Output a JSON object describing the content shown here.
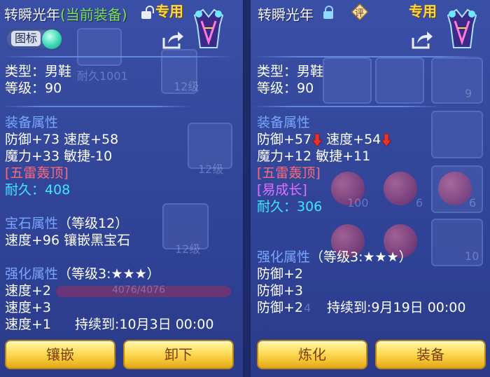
{
  "colors": {
    "panel_bg": "#34489c",
    "section_header": "#78a6ff",
    "special_tag": "#ffd640",
    "current_equip": "#78e05a",
    "durability": "#3fe8ff",
    "red_attr": "#ff6878",
    "purple_attr": "#e070ff",
    "button_gold": "#f6c534",
    "down_arrow": "#e8332b"
  },
  "left": {
    "title": "转瞬光年",
    "current_tag": "(当前装备)",
    "special_tag": "专用",
    "toggle_label": "图标",
    "icons": {
      "lock": "unlocked-lock-icon",
      "share": "share-icon",
      "avatar": "character-avatar-icon"
    },
    "type": "类型：男鞋",
    "level": "等级：90",
    "equip_header": "装备属性",
    "attr_line1": "防御+73 速度+58",
    "attr_line2": "魔力+33 敏捷-10",
    "special_attr": "[五雷轰顶]",
    "durability": "耐久：408",
    "gem_header": "宝石属性",
    "gem_level": "（等级12）",
    "gem_line": "速度+96 镶嵌黑宝石",
    "enh_header": "强化属性",
    "enh_level": "（等级3:★★★）",
    "enh_line1": "速度+2",
    "enh_line2": "速度+3",
    "enh_line3": "速度+1",
    "expire": "持续到:10月3日 00:00",
    "btn_inlay": "镶嵌",
    "btn_unequip": "卸下",
    "bg_text": {
      "dur": "耐久1001",
      "lvl1": "12级",
      "lvl2": "12级",
      "lvl3": "12级",
      "hp": "4076/4076"
    }
  },
  "right": {
    "title": "转瞬光年",
    "eval_badge": "评",
    "special_tag": "专用",
    "icons": {
      "lock": "locked-lock-icon",
      "share": "share-icon",
      "avatar": "character-avatar-icon",
      "arrow": "down-arrow-icon"
    },
    "type": "类型：男鞋",
    "level": "等级：90",
    "equip_header": "装备属性",
    "attr_def": "防御+57",
    "attr_spd": "速度+54",
    "attr_line2": "魔力+12 敏捷+11",
    "special_attr1": "[五雷轰顶]",
    "special_attr2": "[易成长]",
    "durability": "耐久：306",
    "enh_header": "强化属性",
    "enh_level": "（等级3:★★★）",
    "enh_line1": "防御+2",
    "enh_line2": "防御+3",
    "enh_line3": "防御+2",
    "expire": "持续到:9月19日 00:00",
    "btn_refine": "炼化",
    "btn_equip": "装备",
    "bg_text": {
      "n9": "9",
      "n100": "100",
      "n6a": "6",
      "n6b": "6",
      "n10": "10",
      "n4": "4"
    }
  }
}
